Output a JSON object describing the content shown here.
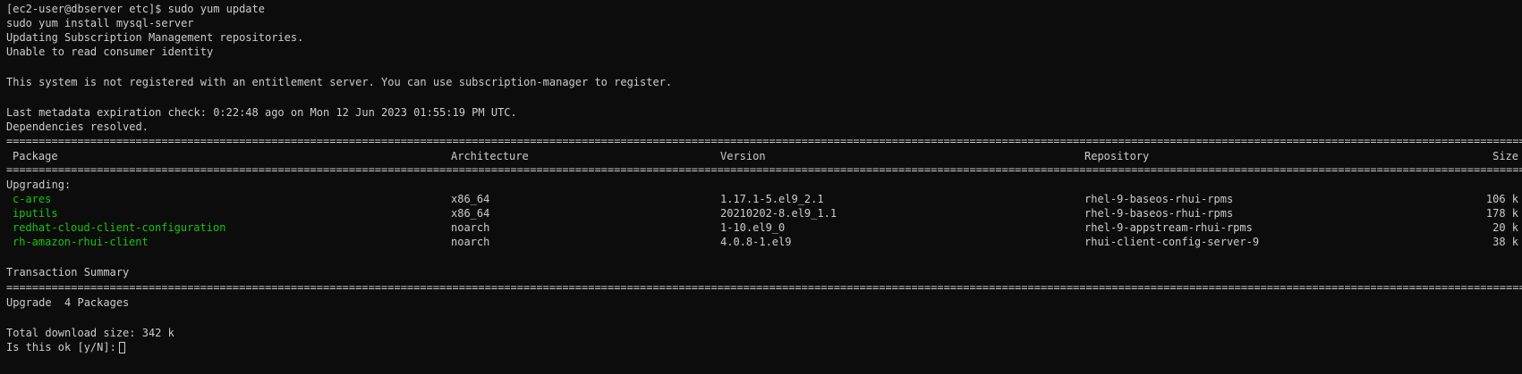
{
  "colors": {
    "background": "#0c0c0c",
    "text": "#cccccc",
    "package_name": "#16c60c"
  },
  "terminal": {
    "lines": {
      "prompt_cmd": "[ec2-user@dbserver etc]$ sudo yum update",
      "cmd_queued": "sudo yum install mysql-server",
      "updating_repos": "Updating Subscription Management repositories.",
      "unable_identity": "Unable to read consumer identity",
      "not_registered": "This system is not registered with an entitlement server. You can use subscription-manager to register.",
      "metadata_check": "Last metadata expiration check: 0:22:48 ago on Mon 12 Jun 2023 01:55:19 PM UTC.",
      "deps_resolved": "Dependencies resolved.",
      "upgrading": "Upgrading:",
      "transaction_summary": "Transaction Summary",
      "upgrade_count": "Upgrade  4 Packages",
      "total_download": "Total download size: 342 k",
      "confirm_prompt": "Is this ok [y/N]: "
    },
    "rule_char_double": "=",
    "table": {
      "headers": {
        "package": "Package",
        "architecture": "Architecture",
        "version": "Version",
        "repository": "Repository",
        "size": "Size"
      },
      "rows": [
        {
          "package": "c-ares",
          "arch": "x86_64",
          "version": "1.17.1-5.el9_2.1",
          "repo": "rhel-9-baseos-rhui-rpms",
          "size": "106 k"
        },
        {
          "package": "iputils",
          "arch": "x86_64",
          "version": "20210202-8.el9_1.1",
          "repo": "rhel-9-baseos-rhui-rpms",
          "size": "178 k"
        },
        {
          "package": "redhat-cloud-client-configuration",
          "arch": "noarch",
          "version": "1-10.el9_0",
          "repo": "rhel-9-appstream-rhui-rpms",
          "size": "20 k"
        },
        {
          "package": "rh-amazon-rhui-client",
          "arch": "noarch",
          "version": "4.0.8-1.el9",
          "repo": "rhui-client-config-server-9",
          "size": "38 k"
        }
      ]
    }
  }
}
